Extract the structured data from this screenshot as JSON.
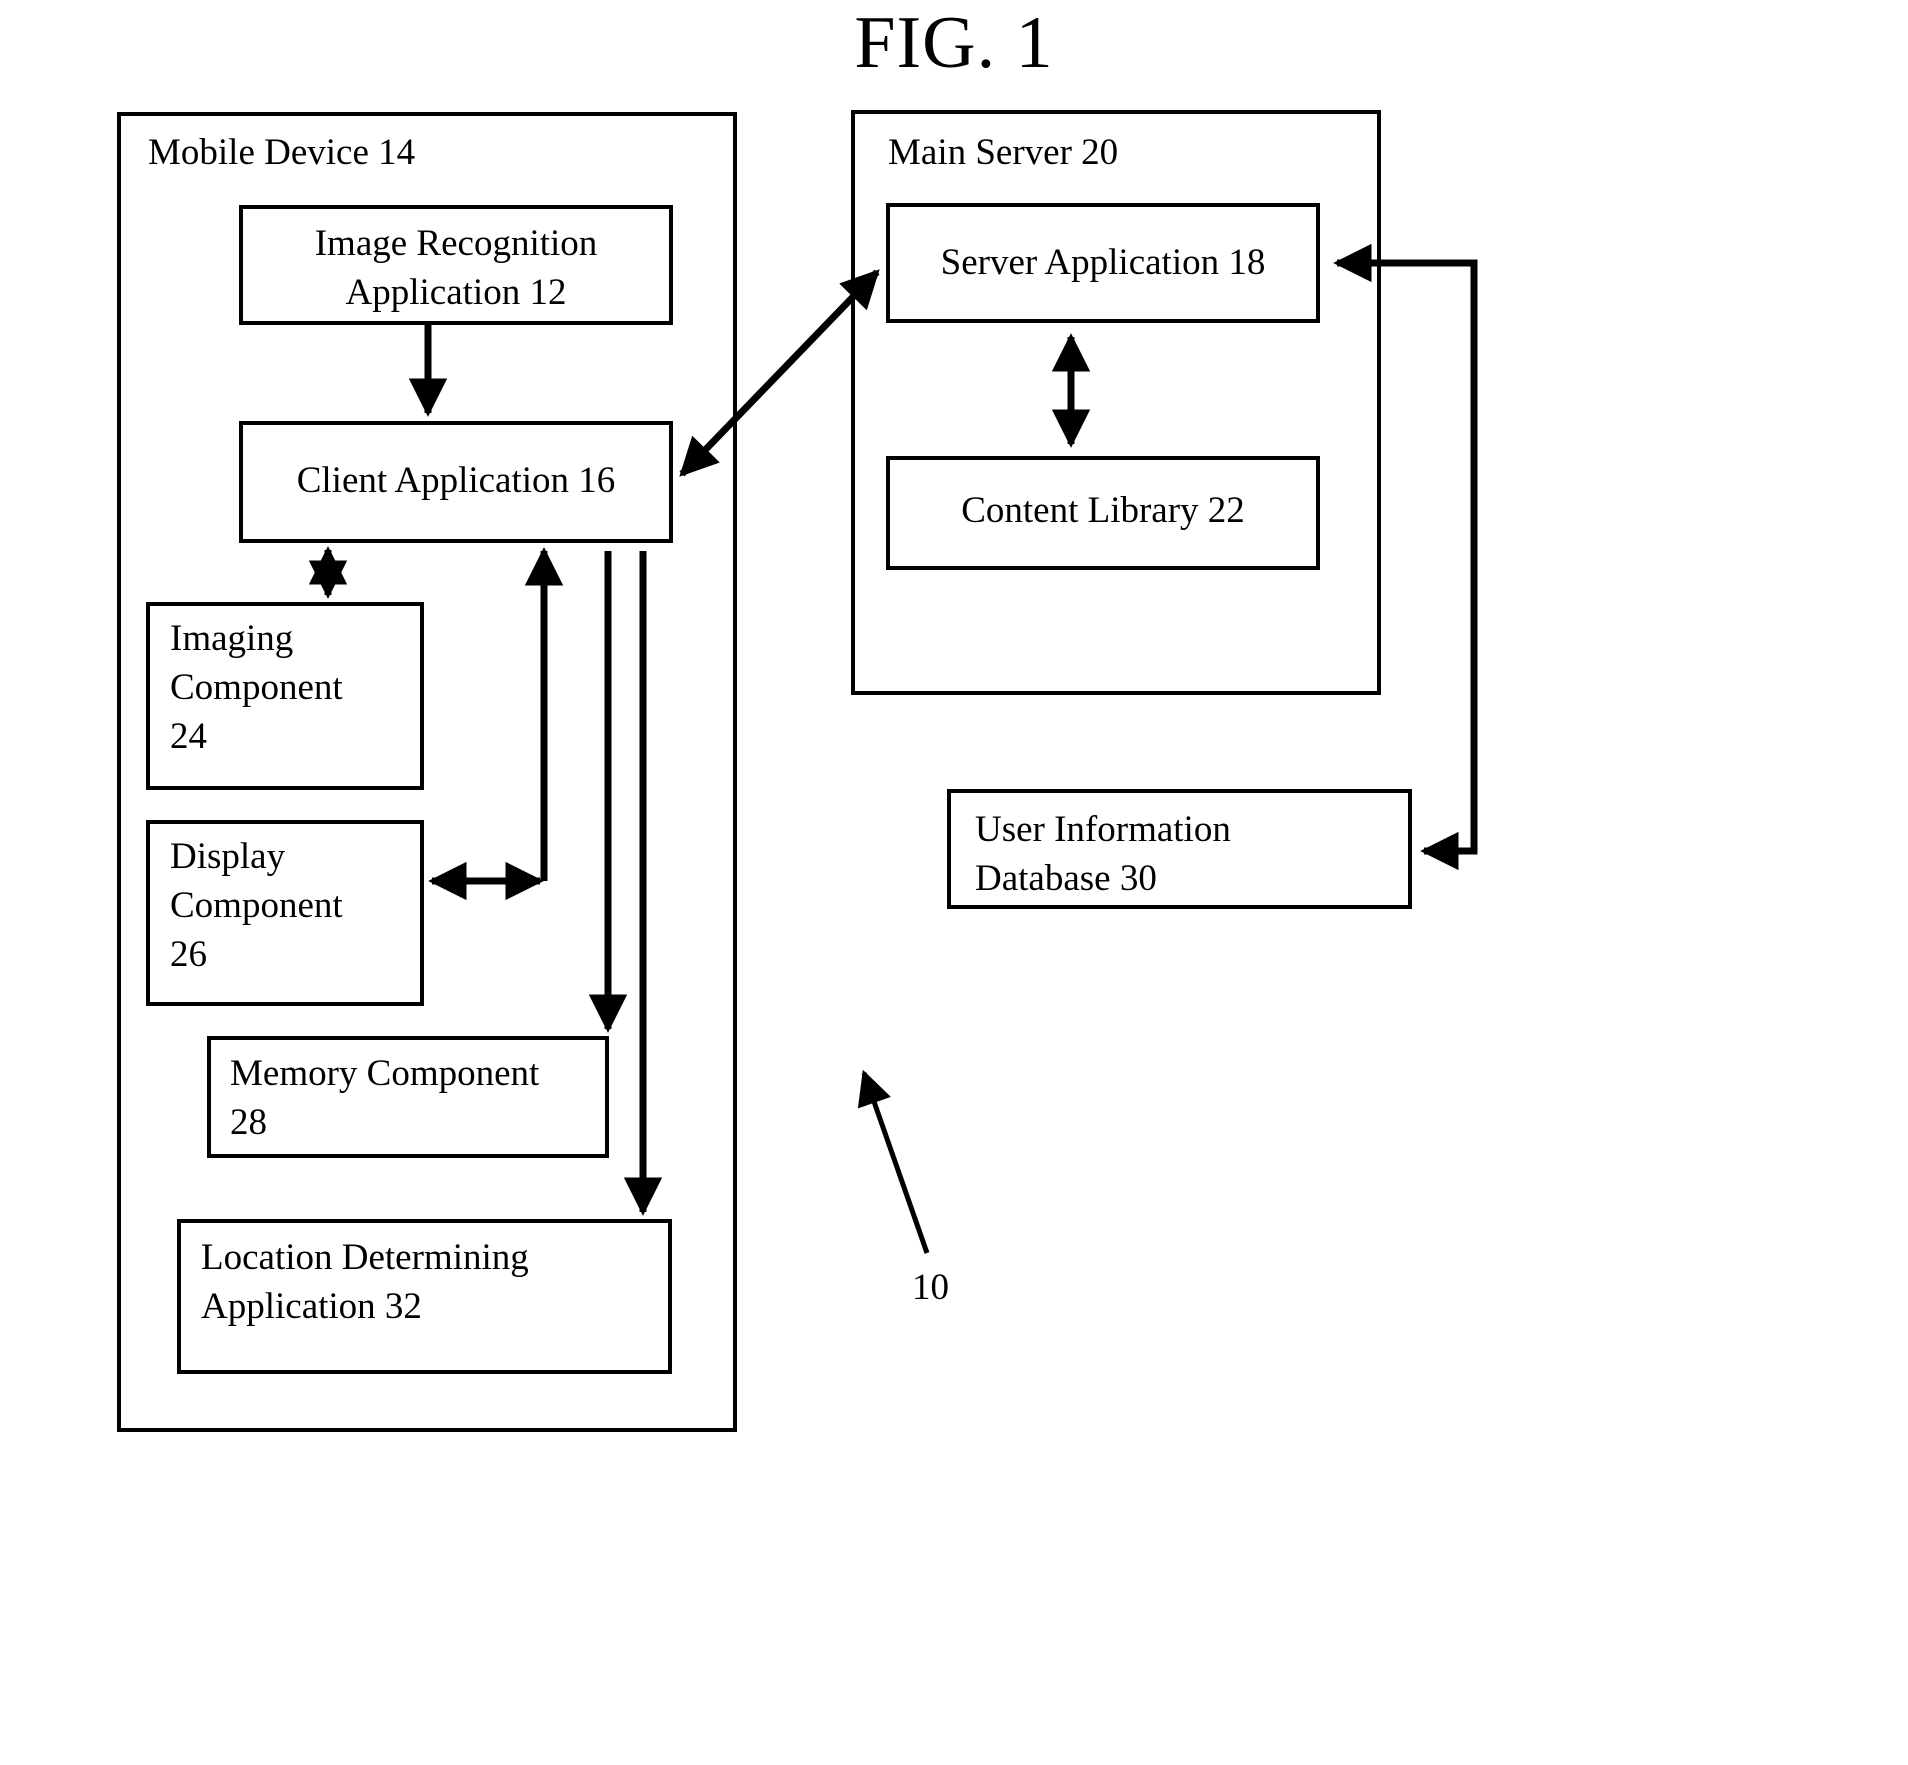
{
  "figure": {
    "title": "FIG. 1",
    "reference_numeral": "10"
  },
  "containers": [
    {
      "id": "mobile-device",
      "label": "Mobile Device 14",
      "name": "Mobile Device",
      "number": "14"
    },
    {
      "id": "main-server",
      "label": "Main Server 20",
      "name": "Main Server",
      "number": "20"
    }
  ],
  "blocks": {
    "image_recognition_application": {
      "label": "Image Recognition\nApplication  12",
      "name": "Image Recognition Application",
      "number": "12"
    },
    "client_application": {
      "label": "Client Application 16",
      "name": "Client Application",
      "number": "16"
    },
    "imaging_component": {
      "label": "Imaging\nComponent\n24",
      "name": "Imaging Component",
      "number": "24"
    },
    "display_component": {
      "label": "Display\nComponent\n26",
      "name": "Display Component",
      "number": "26"
    },
    "memory_component": {
      "label": "Memory Component\n28",
      "name": "Memory Component",
      "number": "28"
    },
    "location_determining_application": {
      "label": "Location Determining\nApplication 32",
      "name": "Location Determining Application",
      "number": "32"
    },
    "server_application": {
      "label": "Server Application 18",
      "name": "Server Application",
      "number": "18"
    },
    "content_library": {
      "label": "Content Library 22",
      "name": "Content Library",
      "number": "22"
    },
    "user_information_database": {
      "label": "User Information\nDatabase 30",
      "name": "User Information Database",
      "number": "30"
    }
  },
  "connectors": [
    {
      "name": "image-recognition-to-client",
      "from": "image_recognition_application",
      "to": "client_application",
      "style": "single-arrow-down"
    },
    {
      "name": "client-to-server-application",
      "from": "client_application",
      "to": "server_application",
      "style": "double-arrow-diagonal"
    },
    {
      "name": "client-to-imaging-component",
      "from": "client_application",
      "to": "imaging_component",
      "style": "double-arrow-vertical"
    },
    {
      "name": "display-component-to-client",
      "from": "display_component",
      "to": "client_application",
      "style": "double-arrow-elbow"
    },
    {
      "name": "client-to-memory-component",
      "from": "client_application",
      "to": "memory_component",
      "style": "single-arrow-down"
    },
    {
      "name": "client-to-location-determining-application",
      "from": "client_application",
      "to": "location_determining_application",
      "style": "single-arrow-down"
    },
    {
      "name": "server-application-to-content-library",
      "from": "server_application",
      "to": "content_library",
      "style": "double-arrow-vertical"
    },
    {
      "name": "user-information-database-to-server-application",
      "from": "user_information_database",
      "to": "server_application",
      "style": "double-arrow-elbow-right"
    },
    {
      "name": "system-reference-leader",
      "from": "figure.reference_numeral",
      "to": "system",
      "style": "leader-arrow"
    }
  ],
  "colors": {
    "stroke": "#000000",
    "background": "#ffffff"
  }
}
